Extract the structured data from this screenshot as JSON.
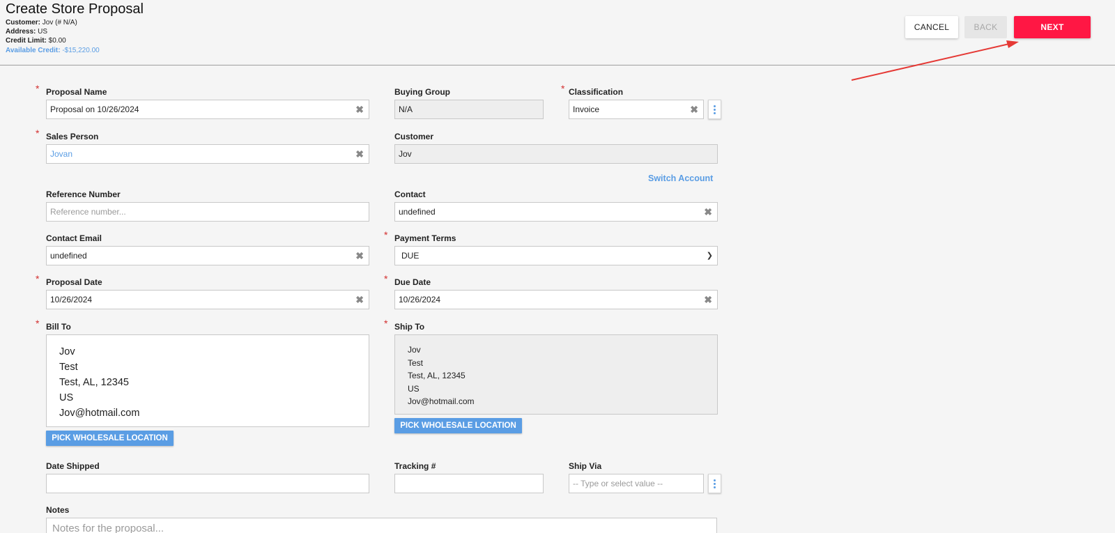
{
  "header": {
    "title": "Create Store Proposal",
    "customer_label": "Customer:",
    "customer_value": "Jov (# N/A)",
    "address_label": "Address:",
    "address_value": "US",
    "credit_limit_label": "Credit Limit:",
    "credit_limit_value": "$0.00",
    "available_credit_label": "Available Credit:",
    "available_credit_value": "-$15,220.00",
    "cancel": "CANCEL",
    "back": "BACK",
    "next": "NEXT"
  },
  "colors": {
    "next": "#ff1744",
    "accent": "#5a9de4",
    "required": "#d32f2f",
    "arrow": "#e53935"
  },
  "form": {
    "proposal_name": {
      "label": "Proposal Name",
      "value": "Proposal on 10/26/2024"
    },
    "buying_group": {
      "label": "Buying Group",
      "value": "N/A"
    },
    "classification": {
      "label": "Classification",
      "value": "Invoice"
    },
    "sales_person": {
      "label": "Sales Person",
      "value": "Jovan"
    },
    "customer": {
      "label": "Customer",
      "value": "Jov"
    },
    "switch_account": "Switch Account",
    "reference_number": {
      "label": "Reference Number",
      "placeholder": "Reference number..."
    },
    "contact": {
      "label": "Contact",
      "value": "undefined"
    },
    "contact_email": {
      "label": "Contact Email",
      "value": "undefined"
    },
    "payment_terms": {
      "label": "Payment Terms",
      "value": "DUE"
    },
    "proposal_date": {
      "label": "Proposal Date",
      "value": "10/26/2024"
    },
    "due_date": {
      "label": "Due Date",
      "value": "10/26/2024"
    },
    "bill_to": {
      "label": "Bill To",
      "lines": [
        "Jov",
        "Test",
        "Test, AL, 12345",
        "US",
        "Jov@hotmail.com"
      ]
    },
    "ship_to": {
      "label": "Ship To",
      "lines": [
        "Jov",
        "Test",
        "Test, AL, 12345",
        "US",
        "Jov@hotmail.com"
      ]
    },
    "pick_location": "PICK WHOLESALE LOCATION",
    "date_shipped": {
      "label": "Date Shipped",
      "value": ""
    },
    "tracking": {
      "label": "Tracking #",
      "value": ""
    },
    "ship_via": {
      "label": "Ship Via",
      "placeholder": "-- Type or select value --"
    },
    "notes": {
      "label": "Notes",
      "placeholder": "Notes for the proposal..."
    }
  },
  "icons": {
    "clear": "clear-x-icon",
    "more": "more-vertical-icon",
    "dropdown": "chevron-down-icon"
  }
}
